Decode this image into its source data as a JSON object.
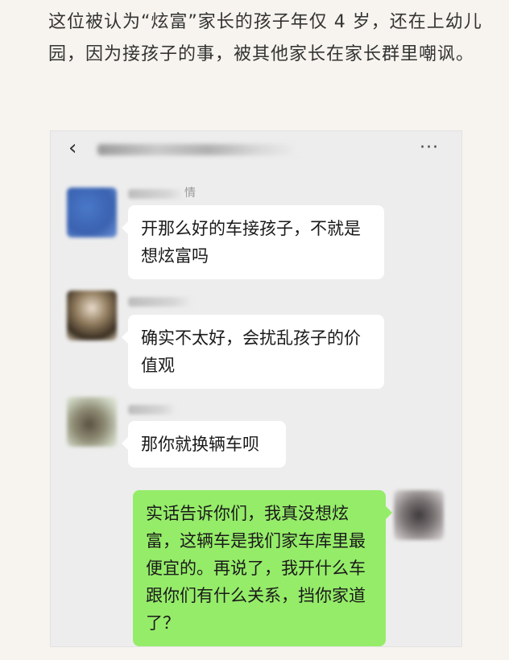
{
  "caption": "这位被认为“炫富”家长的孩子年仅 4 岁，还在上幼儿园，因为接孩子的事，被其他家长在家长群里嘲讽。",
  "chat": {
    "header": {
      "back_icon": "‹",
      "menu_icon": "···"
    },
    "messages": [
      {
        "side": "left",
        "sender_suffix": "情",
        "text": "开那么好的车接孩子，不就是想炫富吗"
      },
      {
        "side": "left",
        "sender_suffix": "",
        "text": "确实不太好，会扰乱孩子的价值观"
      },
      {
        "side": "left",
        "sender_suffix": "",
        "text": "那你就换辆车呗"
      },
      {
        "side": "right",
        "text": "实话告诉你们，我真没想炫富，这辆车是我们家车库里最便宜的。再说了，我开什么车跟你们有什么关系，挡你家道了？"
      }
    ]
  }
}
